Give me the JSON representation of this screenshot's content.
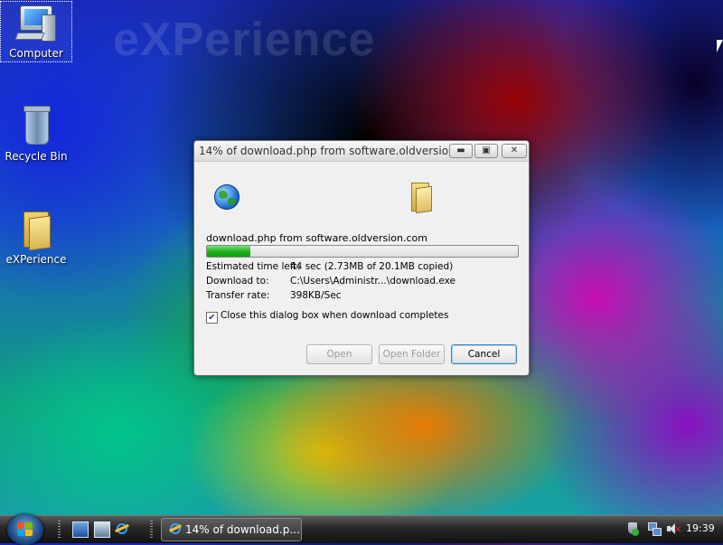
{
  "desktop": {
    "watermark": "eXPerience",
    "icons": [
      {
        "label": "Computer"
      },
      {
        "label": "Recycle Bin"
      },
      {
        "label": "eXPerience"
      }
    ]
  },
  "dialog": {
    "title": "14% of download.php from software.oldversion.c...",
    "file_from": "download.php from software.oldversion.com",
    "progress_percent": 14,
    "estimated_label": "Estimated time left:",
    "estimated_value": "44 sec (2.73MB of 20.1MB copied)",
    "download_to_label": "Download to:",
    "download_to_value": "C:\\Users\\Administr...\\download.exe",
    "transfer_rate_label": "Transfer rate:",
    "transfer_rate_value": "398KB/Sec",
    "close_checkbox_label": "Close this dialog box when download completes",
    "close_checkbox_checked": true,
    "buttons": {
      "open": "Open",
      "open_folder": "Open Folder",
      "cancel": "Cancel"
    }
  },
  "taskbar": {
    "task_label": "14% of download.p...",
    "clock": "19:39"
  },
  "colors": {
    "progress_fill": "#22b522",
    "default_button_border": "#3c7fb1"
  }
}
